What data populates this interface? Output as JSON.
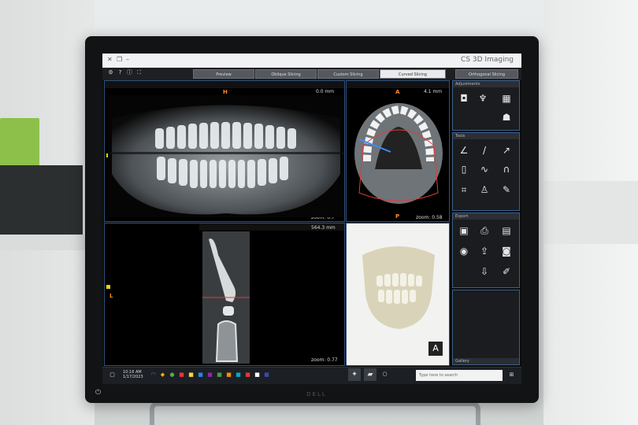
{
  "app": {
    "title": "CS 3D Imaging",
    "tabs": [
      "Preview",
      "Oblique Slicing",
      "Custom Slicing",
      "Curved Slicing",
      "Orthogonal Slicing"
    ],
    "active_tab": "Curved Slicing"
  },
  "viewports": {
    "panoramic": {
      "top_label": "H",
      "top_readout": "0.0 mm",
      "zoom": "zoom: 0.7"
    },
    "axial": {
      "top_readout": "4.1 mm",
      "orient_a": "A",
      "orient_p": "P",
      "zoom": "zoom: 0.58"
    },
    "cross_section": {
      "top_readout": "564.3 mm",
      "left_label": "L",
      "zoom": "zoom: 0.77"
    },
    "volume": {
      "orient_badge": "A"
    }
  },
  "panels": {
    "adjustments": {
      "title": "Adjustments"
    },
    "tools": {
      "title": "Tools"
    },
    "export": {
      "title": "Export"
    },
    "gallery": {
      "title": "Gallery"
    }
  },
  "taskbar": {
    "search_placeholder": "Type here to search",
    "time": "10:16 AM",
    "date": "1/17/2023"
  },
  "monitor": {
    "brand": "DELL"
  },
  "colors": {
    "accent": "#2d4f7a",
    "orientation": "#ff8c2a",
    "marker": "#f0d300"
  }
}
